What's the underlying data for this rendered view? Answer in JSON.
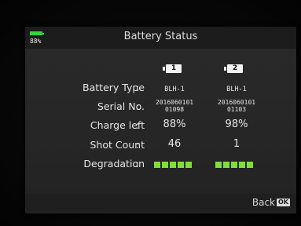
{
  "header": {
    "battery_percent": "88%",
    "title": "Battery Status"
  },
  "columns": [
    {
      "label": "1"
    },
    {
      "label": "2"
    }
  ],
  "rows": {
    "battery_type": {
      "label": "Battery Type",
      "values": [
        "BLH-1",
        "BLH-1"
      ]
    },
    "serial_no": {
      "label": "Serial No.",
      "values": [
        {
          "line1": "2016060101",
          "line2": "01098"
        },
        {
          "line1": "2016060101",
          "line2": "01103"
        }
      ]
    },
    "charge_left": {
      "label": "Charge left",
      "values": [
        "88%",
        "98%"
      ]
    },
    "shot_count": {
      "label": "Shot Count",
      "values": [
        "46",
        "1"
      ]
    },
    "degradation": {
      "label": "Degradation",
      "levels": [
        5,
        5
      ],
      "max_level": 5
    }
  },
  "separator": ":",
  "footer": {
    "back_label": "Back",
    "ok_label": "OK"
  },
  "colors": {
    "battery_green": "#38d23a",
    "degradation_green": "#7fdf3a"
  }
}
